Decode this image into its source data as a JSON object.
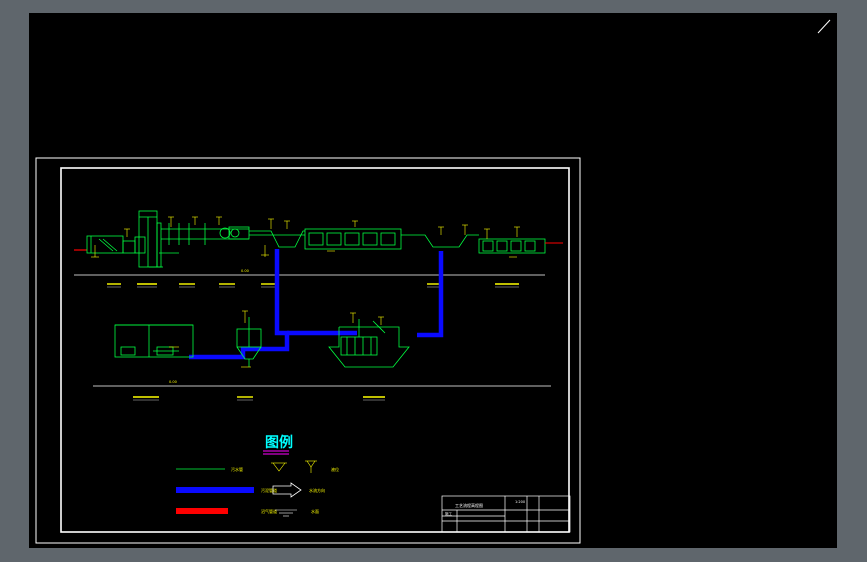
{
  "colors": {
    "background": "#000000",
    "chrome": "#5f666c",
    "frame": "#ffffff",
    "water_line": "#00ff40",
    "sludge_line": "#0a0aff",
    "gas_line": "#ff0000",
    "label": "#ffff00",
    "legend_title": "#00ffff",
    "legend_underline": "#ff00ff"
  },
  "legend": {
    "title": "图例",
    "items": [
      {
        "line_label": "污水管",
        "symbol_label": "液位"
      },
      {
        "line_label": "污泥管道",
        "symbol_label": "水流方向"
      },
      {
        "line_label": "沼气管道",
        "symbol_label": "水面"
      }
    ]
  },
  "title_block": {
    "drawing_title": "工艺流程高程图",
    "scale": "1:200",
    "code": "施工"
  },
  "elevation_markers": {
    "upper": "0.00",
    "lower": "0.00"
  }
}
